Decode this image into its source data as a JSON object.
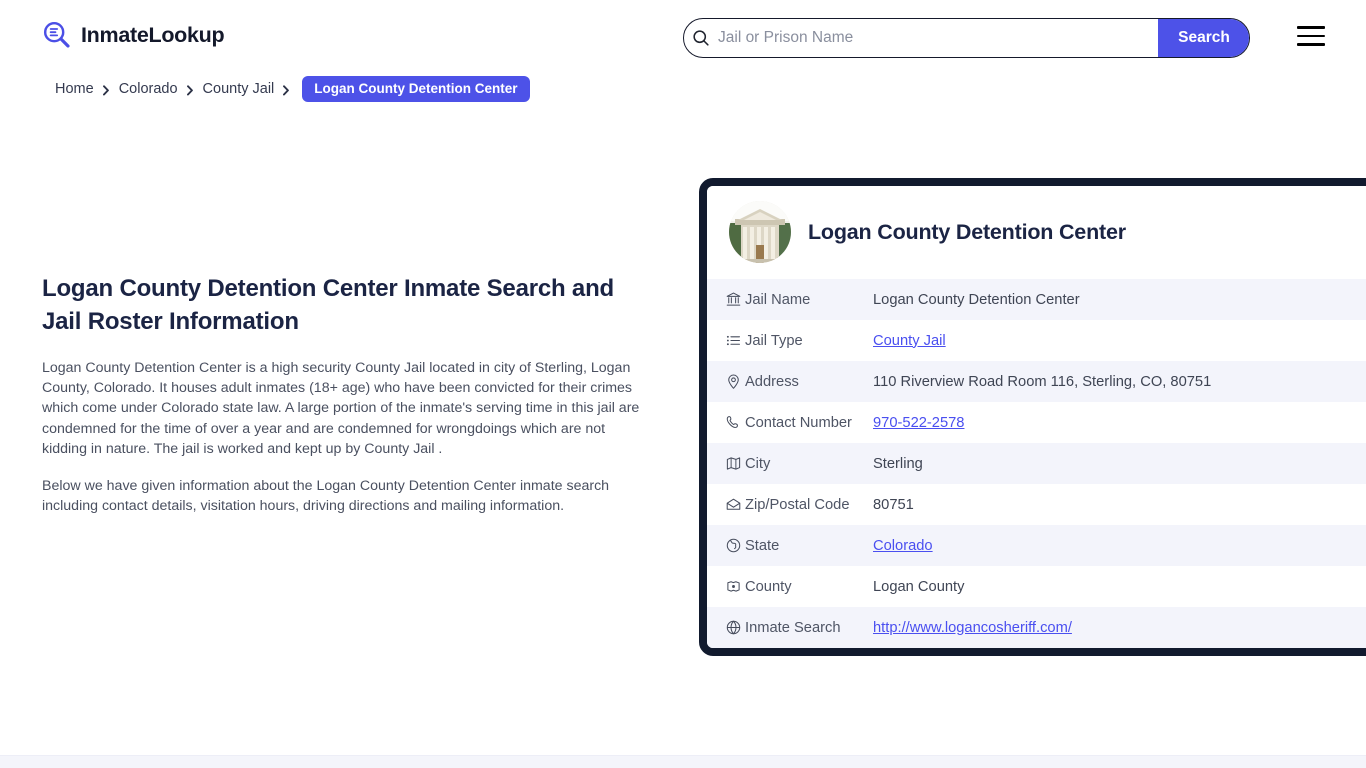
{
  "brand": {
    "name": "InmateLookup",
    "logo_icon": "magnifier-list-icon",
    "accent_color": "#4d52e8"
  },
  "search": {
    "placeholder": "Jail or Prison Name",
    "value": "",
    "button_label": "Search",
    "icon": "search-icon"
  },
  "menu": {
    "icon": "hamburger-menu-icon"
  },
  "breadcrumb": {
    "items": [
      {
        "label": "Home",
        "current": false
      },
      {
        "label": "Colorado",
        "current": false
      },
      {
        "label": "County Jail",
        "current": false
      },
      {
        "label": "Logan County Detention Center",
        "current": true
      }
    ],
    "separator_icon": "chevron-right-icon"
  },
  "main": {
    "title": "Logan County Detention Center Inmate Search and Jail Roster Information",
    "paragraphs": [
      "Logan County Detention Center is a high security County Jail located in city of Sterling, Logan County, Colorado. It houses adult inmates (18+ age) who have been convicted for their crimes which come under Colorado state law. A large portion of the inmate's serving time in this jail are condemned for the time of over a year and are condemned for wrongdoings which are not kidding in nature. The jail is worked and kept up by County Jail .",
      "Below we have given information about the Logan County Detention Center inmate search including contact details, visitation hours, driving directions and mailing information."
    ]
  },
  "card": {
    "title": "Logan County Detention Center",
    "thumbnail_icon": "courthouse-building-photo",
    "rows": [
      {
        "icon": "bank-icon",
        "label": "Jail Name",
        "value": "Logan County Detention Center",
        "link": false
      },
      {
        "icon": "list-icon",
        "label": "Jail Type",
        "value": "County Jail",
        "link": true
      },
      {
        "icon": "map-pin-icon",
        "label": "Address",
        "value": "110 Riverview Road Room 116, Sterling, CO, 80751",
        "link": false
      },
      {
        "icon": "phone-icon",
        "label": "Contact Number",
        "value": "970-522-2578",
        "link": true
      },
      {
        "icon": "map-icon",
        "label": "City",
        "value": "Sterling",
        "link": false
      },
      {
        "icon": "envelope-icon",
        "label": "Zip/Postal Code",
        "value": "80751",
        "link": false
      },
      {
        "icon": "globe-americas-icon",
        "label": "State",
        "value": "Colorado",
        "link": true
      },
      {
        "icon": "county-map-icon",
        "label": "County",
        "value": "Logan County",
        "link": false
      },
      {
        "icon": "globe-icon",
        "label": "Inmate Search",
        "value": "http://www.logancosheriff.com/",
        "link": true
      }
    ]
  }
}
